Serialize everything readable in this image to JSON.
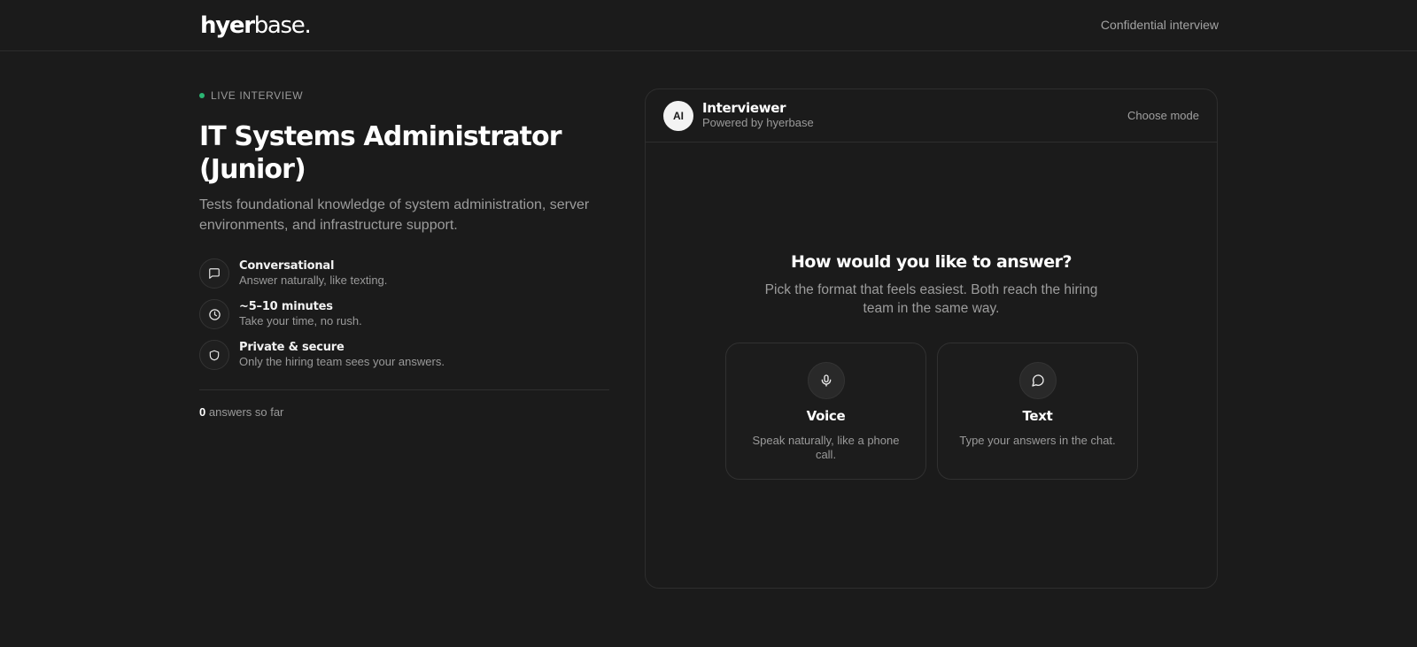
{
  "header": {
    "logo_bold": "hyer",
    "logo_light": "base.",
    "right_text": "Confidential interview"
  },
  "left": {
    "live_label": "LIVE INTERVIEW",
    "title": "IT Systems Administrator (Junior)",
    "description": "Tests foundational knowledge of system administration, server environments, and infrastructure support.",
    "features": [
      {
        "icon": "chat-bubble-icon",
        "title": "Conversational",
        "subtitle": "Answer naturally, like texting."
      },
      {
        "icon": "clock-icon",
        "title": "~5–10 minutes",
        "subtitle": "Take your time, no rush."
      },
      {
        "icon": "shield-icon",
        "title": "Private & secure",
        "subtitle": "Only the hiring team sees your answers."
      }
    ],
    "answers_count": "0",
    "answers_label": "answers so far"
  },
  "panel": {
    "avatar": "AI",
    "title": "Interviewer",
    "subtitle": "Powered by hyerbase",
    "choose_mode": "Choose mode",
    "prompt_title": "How would you like to answer?",
    "prompt_sub": "Pick the format that feels easiest. Both reach the hiring team in the same way.",
    "options": [
      {
        "icon": "microphone-icon",
        "title": "Voice",
        "subtitle": "Speak naturally, like a phone call."
      },
      {
        "icon": "chat-bubble-icon",
        "title": "Text",
        "subtitle": "Type your answers in the chat."
      }
    ]
  },
  "colors": {
    "background": "#1b1b1b",
    "live_dot": "#2bb673",
    "text_primary": "#ffffff",
    "text_muted": "#9a9a9a"
  }
}
